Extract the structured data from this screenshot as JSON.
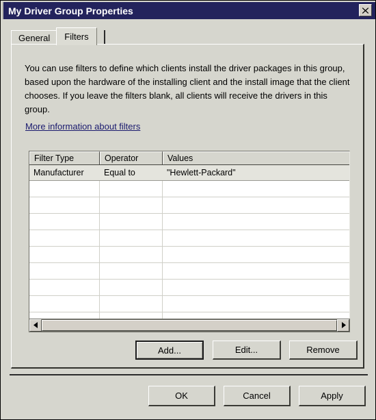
{
  "window": {
    "title": "My Driver Group Properties",
    "close_icon": "close-icon"
  },
  "tabs": [
    {
      "label": "General",
      "active": false
    },
    {
      "label": "Filters",
      "active": true
    }
  ],
  "page": {
    "description": "You can use filters to define which clients install the driver packages in this group, based upon the hardware of the installing client and the install image that the client chooses. If you leave the filters blank, all clients will receive the drivers in this group.",
    "link_label": "More information about filters",
    "link_color": "#1a1a6e"
  },
  "grid": {
    "columns": [
      "Filter Type",
      "Operator",
      "Values"
    ],
    "rows": [
      [
        "Manufacturer",
        "Equal to",
        "\"Hewlett-Packard\""
      ]
    ],
    "empty_row_count": 8,
    "scrollbar": {
      "left_arrow_icon": "triangle-left-icon",
      "right_arrow_icon": "triangle-right-icon",
      "thumb_position": "full"
    }
  },
  "filter_actions": {
    "add_label": "Add...",
    "edit_label": "Edit...",
    "remove_label": "Remove"
  },
  "dialog_actions": {
    "ok_label": "OK",
    "cancel_label": "Cancel",
    "apply_label": "Apply"
  },
  "colors": {
    "titlebar": "#23235c",
    "dialog_face": "#d6d6ce",
    "grid_background": "#ffffff",
    "data_row": "#e4e4dd"
  }
}
